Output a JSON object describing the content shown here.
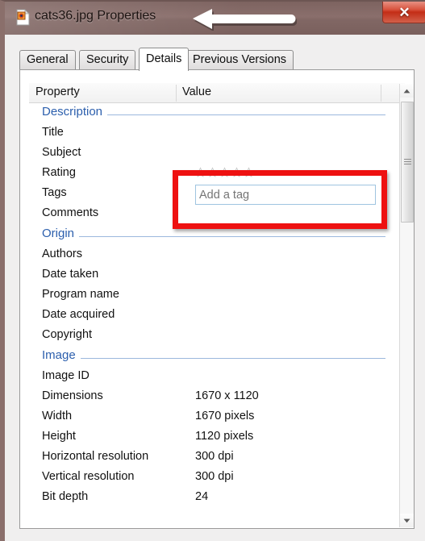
{
  "window": {
    "title": "cats36.jpg Properties",
    "icon": "image-file-icon",
    "close_label": "✕",
    "annotation": "left-arrow-annotation",
    "accent_red": "#ee1111",
    "titlebar_color": "#806663"
  },
  "tabs": [
    {
      "label": "General",
      "active": false
    },
    {
      "label": "Security",
      "active": false
    },
    {
      "label": "Details",
      "active": true
    },
    {
      "label": "Previous Versions",
      "active": false
    }
  ],
  "list": {
    "columns": [
      "Property",
      "Value"
    ],
    "sections": [
      {
        "name": "Description",
        "rows": [
          {
            "property": "Title",
            "value": ""
          },
          {
            "property": "Subject",
            "value": ""
          },
          {
            "property": "Rating",
            "value": "",
            "control": "stars",
            "stars_total": 5,
            "stars_filled": 0
          },
          {
            "property": "Tags",
            "value": "",
            "control": "tag-input",
            "placeholder": "Add a tag"
          },
          {
            "property": "Comments",
            "value": ""
          }
        ]
      },
      {
        "name": "Origin",
        "rows": [
          {
            "property": "Authors",
            "value": ""
          },
          {
            "property": "Date taken",
            "value": ""
          },
          {
            "property": "Program name",
            "value": ""
          },
          {
            "property": "Date acquired",
            "value": ""
          },
          {
            "property": "Copyright",
            "value": ""
          }
        ]
      },
      {
        "name": "Image",
        "rows": [
          {
            "property": "Image ID",
            "value": ""
          },
          {
            "property": "Dimensions",
            "value": "1670 x 1120"
          },
          {
            "property": "Width",
            "value": "1670 pixels"
          },
          {
            "property": "Height",
            "value": "1120 pixels"
          },
          {
            "property": "Horizontal resolution",
            "value": "300 dpi"
          },
          {
            "property": "Vertical resolution",
            "value": "300 dpi"
          },
          {
            "property": "Bit depth",
            "value": "24"
          }
        ]
      }
    ]
  }
}
